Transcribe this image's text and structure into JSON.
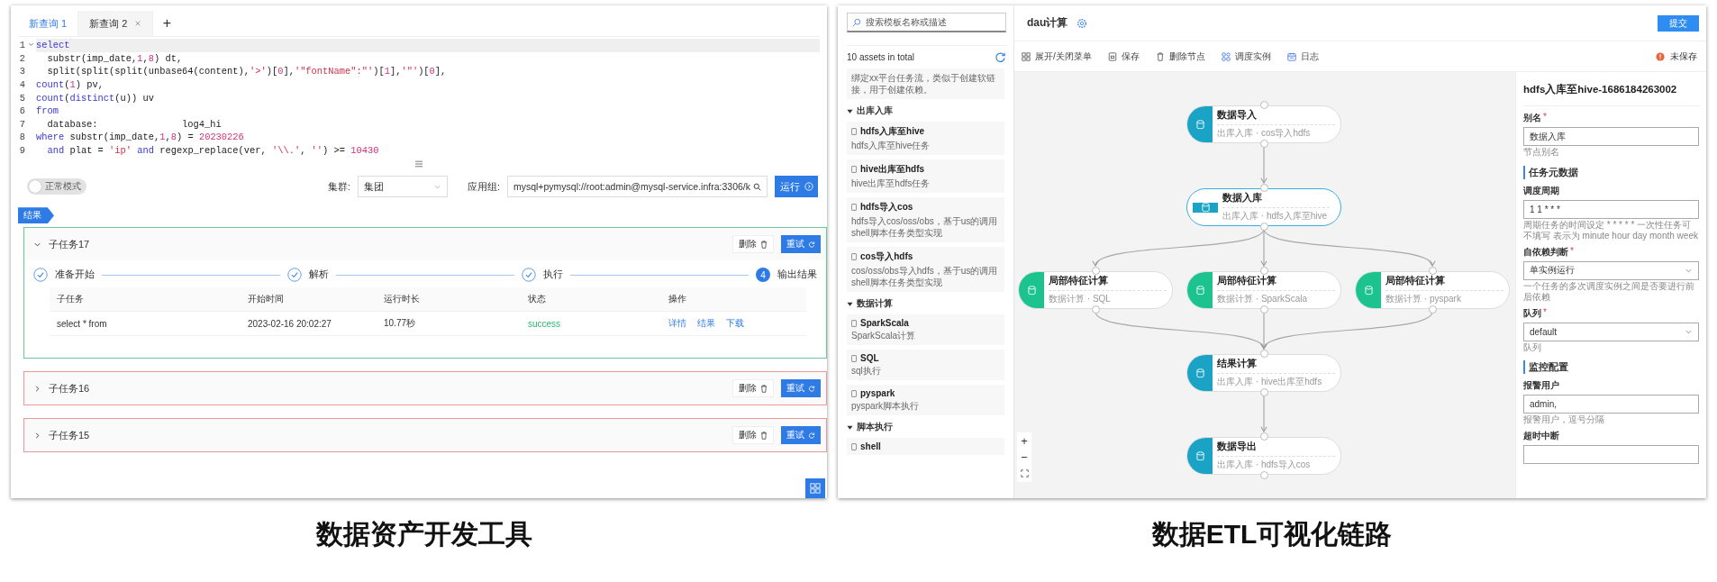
{
  "left": {
    "tabs": [
      {
        "label": "新查询 1",
        "selected": true,
        "closable": false
      },
      {
        "label": "新查询 2",
        "selected": false,
        "closable": true
      }
    ],
    "add_tab": "+",
    "editor": {
      "lines": [
        {
          "no": "1",
          "fold": true,
          "current": true,
          "tokens": [
            {
              "t": "select",
              "kind": "kw"
            }
          ]
        },
        {
          "no": "2",
          "fold": false,
          "current": false,
          "tokens": [
            {
              "t": "  substr(imp_date,",
              "kind": "plain"
            },
            {
              "t": "1",
              "kind": "num"
            },
            {
              "t": ",",
              "kind": "plain"
            },
            {
              "t": "8",
              "kind": "num"
            },
            {
              "t": ") dt,",
              "kind": "plain"
            }
          ]
        },
        {
          "no": "3",
          "fold": false,
          "current": false,
          "tokens": [
            {
              "t": "  split(split(split(unbase64(content),",
              "kind": "plain"
            },
            {
              "t": "'>'",
              "kind": "str"
            },
            {
              "t": ")[",
              "kind": "plain"
            },
            {
              "t": "0",
              "kind": "num"
            },
            {
              "t": "],",
              "kind": "plain"
            },
            {
              "t": "'\"fontName\":\"'",
              "kind": "str"
            },
            {
              "t": ")[",
              "kind": "plain"
            },
            {
              "t": "1",
              "kind": "num"
            },
            {
              "t": "],",
              "kind": "plain"
            },
            {
              "t": "'\"'",
              "kind": "str"
            },
            {
              "t": ")[",
              "kind": "plain"
            },
            {
              "t": "0",
              "kind": "num"
            },
            {
              "t": "],",
              "kind": "plain"
            }
          ]
        },
        {
          "no": "4",
          "fold": false,
          "current": false,
          "tokens": [
            {
              "t": "count",
              "kind": "kw"
            },
            {
              "t": "(",
              "kind": "plain"
            },
            {
              "t": "1",
              "kind": "num"
            },
            {
              "t": ") pv,",
              "kind": "plain"
            }
          ]
        },
        {
          "no": "5",
          "fold": false,
          "current": false,
          "tokens": [
            {
              "t": "count",
              "kind": "kw"
            },
            {
              "t": "(",
              "kind": "plain"
            },
            {
              "t": "distinct",
              "kind": "kw"
            },
            {
              "t": "(u)) uv",
              "kind": "plain"
            }
          ]
        },
        {
          "no": "6",
          "fold": false,
          "current": false,
          "tokens": [
            {
              "t": "from",
              "kind": "kw"
            }
          ]
        },
        {
          "no": "7",
          "fold": false,
          "current": false,
          "tokens": [
            {
              "t": "  database:               log4_hi",
              "kind": "plain"
            }
          ]
        },
        {
          "no": "8",
          "fold": false,
          "current": false,
          "tokens": [
            {
              "t": "where",
              "kind": "kw"
            },
            {
              "t": " substr(imp_date,",
              "kind": "plain"
            },
            {
              "t": "1",
              "kind": "num"
            },
            {
              "t": ",",
              "kind": "plain"
            },
            {
              "t": "8",
              "kind": "num"
            },
            {
              "t": ") = ",
              "kind": "plain"
            },
            {
              "t": "20230226",
              "kind": "num"
            }
          ]
        },
        {
          "no": "9",
          "fold": false,
          "current": false,
          "tokens": [
            {
              "t": "  and",
              "kind": "kw"
            },
            {
              "t": " plat = ",
              "kind": "plain"
            },
            {
              "t": "'ip'",
              "kind": "str"
            },
            {
              "t": " and",
              "kind": "kw"
            },
            {
              "t": " regexp_replace(ver, ",
              "kind": "plain"
            },
            {
              "t": "'\\\\.'",
              "kind": "str"
            },
            {
              "t": ", ",
              "kind": "plain"
            },
            {
              "t": "''",
              "kind": "str"
            },
            {
              "t": ") >= ",
              "kind": "plain"
            },
            {
              "t": "10430",
              "kind": "num"
            }
          ]
        }
      ]
    },
    "controls": {
      "toggle": {
        "label": "正常模式",
        "on": false
      },
      "cluster": {
        "label": "集群:",
        "value": "集团"
      },
      "app_group": {
        "label": "应用组:",
        "value": "mysql+pymysql://root:admin@mysql-service.infra:3306/k"
      },
      "run": "运行"
    },
    "result_tag": "结果",
    "tasks": [
      {
        "title": "子任务17",
        "expanded": true,
        "color": "#6cc79a",
        "delete": "删除",
        "retry": "重试",
        "steps": [
          {
            "label": "准备开始",
            "done": true
          },
          {
            "label": "解析",
            "done": true
          },
          {
            "label": "执行",
            "done": true
          },
          {
            "number": "4",
            "label": "输出结果",
            "done": false
          }
        ],
        "table": {
          "columns": [
            "子任务",
            "开始时间",
            "运行时长",
            "状态",
            "操作"
          ],
          "rows": [
            {
              "name": "select * from",
              "start": "2023-02-16 20:02:27",
              "duration": "10.77秒",
              "status": "success",
              "actions": [
                "详情",
                "结果",
                "下载"
              ]
            }
          ]
        }
      },
      {
        "title": "子任务16",
        "expanded": false,
        "color": "#e89a9a",
        "delete": "删除",
        "retry": "重试"
      },
      {
        "title": "子任务15",
        "expanded": false,
        "color": "#e89a9a",
        "delete": "删除",
        "retry": "重试"
      }
    ],
    "caption": "数据资产开发工具"
  },
  "right": {
    "sidebar": {
      "search": {
        "placeholder": "搜索模板名称或描述"
      },
      "count": "10 assets in total",
      "lead_description": "绑定xx平台任务流，类似于创建软链接，用于创建依赖。",
      "groups": [
        {
          "title": "出库入库",
          "expanded": true,
          "items": [
            {
              "name": "hdfs入库至hive",
              "desc": "hdfs入库至hive任务"
            },
            {
              "name": "hive出库至hdfs",
              "desc": "hive出库至hdfs任务"
            },
            {
              "name": "hdfs导入cos",
              "desc": "hdfs导入cos/oss/obs，基于us的调用shell脚本任务类型实现"
            },
            {
              "name": "cos导入hdfs",
              "desc": "cos/oss/obs导入hdfs，基于us的调用shell脚本任务类型实现"
            }
          ]
        },
        {
          "title": "数据计算",
          "expanded": true,
          "items": [
            {
              "name": "SparkScala",
              "desc": "SparkScala计算"
            },
            {
              "name": "SQL",
              "desc": "sql执行"
            },
            {
              "name": "pyspark",
              "desc": "pyspark脚本执行"
            }
          ]
        },
        {
          "title": "脚本执行",
          "expanded": true,
          "items": [
            {
              "name": "shell"
            }
          ]
        }
      ]
    },
    "title": "dau计算",
    "submit": "提交",
    "toolbar": [
      {
        "label": "展开/关闭菜单",
        "kind": "menu"
      },
      {
        "label": "保存",
        "kind": "save"
      },
      {
        "label": "删除节点",
        "kind": "delete"
      },
      {
        "label": "调度实例",
        "kind": "instances"
      },
      {
        "label": "日志",
        "kind": "log"
      }
    ],
    "unsaved": "未保存",
    "levels": [
      [
        {
          "title": "数据导入",
          "subtitle": "出库入库 · cos导入hdfs",
          "color": "#1ba3c6",
          "selected": false
        }
      ],
      [
        {
          "title": "数据入库",
          "subtitle": "出库入库 · hdfs入库至hive",
          "color": "#1ba3c6",
          "selected": true
        }
      ],
      [
        {
          "title": "局部特征计算",
          "subtitle": "数据计算 · SQL",
          "color": "#1cc38e",
          "selected": false
        },
        {
          "title": "局部特征计算",
          "subtitle": "数据计算 · SparkScala",
          "color": "#1cc38e",
          "selected": false
        },
        {
          "title": "局部特征计算",
          "subtitle": "数据计算 · pyspark",
          "color": "#1cc38e",
          "selected": false
        }
      ],
      [
        {
          "title": "结果计算",
          "subtitle": "出库入库 · hive出库至hdfs",
          "color": "#1ba3c6",
          "selected": false
        }
      ],
      [
        {
          "title": "数据导出",
          "subtitle": "出库入库 · hdfs导入cos",
          "color": "#1ba3c6",
          "selected": false
        }
      ]
    ],
    "zoom": {
      "in": "+",
      "out": "−"
    },
    "form": {
      "title": "hdfs入库至hive-1686184263002",
      "fields": [
        {
          "kind": "input",
          "label": "别名",
          "required_mark": "*",
          "value": "数据入库",
          "help": "节点别名"
        },
        {
          "kind": "section",
          "label": "任务元数据"
        },
        {
          "kind": "input",
          "label": "调度周期",
          "value": "1 1 * * *",
          "help": "周期任务的时间设定 * * * * * 一次性任务可不填写 表示为 minute hour day month week"
        },
        {
          "kind": "select",
          "label": "自依赖判断",
          "required_mark": "*",
          "value": "单实例运行",
          "help": "一个任务的多次调度实例之间是否要进行前后依赖"
        },
        {
          "kind": "select",
          "label": "队列",
          "required_mark": "*",
          "value": "default",
          "help": "队列"
        },
        {
          "kind": "section",
          "label": "监控配置"
        },
        {
          "kind": "input",
          "label": "报警用户",
          "value": "admin,",
          "help": "报警用户，逗号分隔"
        },
        {
          "kind": "input",
          "label": "超时中断"
        }
      ]
    },
    "caption": "数据ETL可视化链路"
  }
}
